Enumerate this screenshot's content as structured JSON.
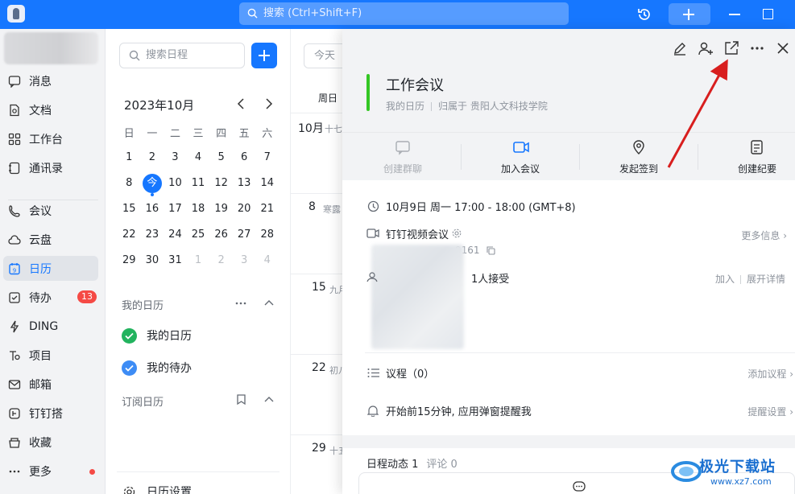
{
  "topbar": {
    "search_placeholder": "搜索 (Ctrl+Shift+F)",
    "accent": "#1677ff"
  },
  "nav": {
    "items": [
      {
        "label": "消息",
        "icon": "message-icon"
      },
      {
        "label": "文档",
        "icon": "document-icon"
      },
      {
        "label": "工作台",
        "icon": "workbench-icon"
      },
      {
        "label": "通讯录",
        "icon": "contacts-icon"
      },
      {
        "label": "会议",
        "icon": "meeting-icon"
      },
      {
        "label": "云盘",
        "icon": "cloud-drive-icon"
      },
      {
        "label": "日历",
        "icon": "calendar-icon",
        "active": true
      },
      {
        "label": "待办",
        "icon": "todo-icon",
        "badge": "13"
      },
      {
        "label": "DING",
        "icon": "lightning-icon"
      },
      {
        "label": "项目",
        "icon": "project-icon"
      },
      {
        "label": "邮箱",
        "icon": "mail-icon"
      },
      {
        "label": "钉钉搭",
        "icon": "builder-icon"
      },
      {
        "label": "收藏",
        "icon": "favorites-icon"
      },
      {
        "label": "更多",
        "icon": "more-icon",
        "dot": true
      }
    ]
  },
  "calendar": {
    "search_placeholder": "搜索日程",
    "month_title": "2023年10月",
    "weekdays": [
      "日",
      "一",
      "二",
      "三",
      "四",
      "五",
      "六"
    ],
    "weeks": [
      [
        "1",
        "2",
        "3",
        "4",
        "5",
        "6",
        "7"
      ],
      [
        "8",
        "今",
        "10",
        "11",
        "12",
        "13",
        "14"
      ],
      [
        "15",
        "16",
        "17",
        "18",
        "19",
        "20",
        "21"
      ],
      [
        "22",
        "23",
        "24",
        "25",
        "26",
        "27",
        "28"
      ],
      [
        "29",
        "30",
        "31",
        "1",
        "2",
        "3",
        "4"
      ]
    ],
    "my_calendars_title": "我的日历",
    "my_calendars": [
      {
        "label": "我的日历",
        "color": "#22b35e"
      },
      {
        "label": "我的待办",
        "color": "#3d8cf5"
      }
    ],
    "subscribed_title": "订阅日历",
    "settings_label": "日历设置"
  },
  "week": {
    "today_label": "今天",
    "header": "周日",
    "days": [
      {
        "num": "10月",
        "lunar": "十七"
      },
      {
        "num": "8",
        "lunar": "寒露"
      },
      {
        "num": "15",
        "lunar": "九月"
      },
      {
        "num": "22",
        "lunar": "初八"
      },
      {
        "num": "29",
        "lunar": "十五"
      }
    ]
  },
  "event": {
    "title": "工作会议",
    "calendar": "我的日历",
    "owner": "归属于 贵阳人文科技学院",
    "color": "#34c724",
    "actions": [
      {
        "label": "创建群聊",
        "icon": "chat-bubble-icon",
        "disabled": true
      },
      {
        "label": "加入会议",
        "icon": "video-camera-icon"
      },
      {
        "label": "发起签到",
        "icon": "location-pin-icon"
      },
      {
        "label": "创建纪要",
        "icon": "notes-icon"
      }
    ],
    "time": "10月9日 周一 17:00 - 18:00 (GMT+8)",
    "video_meeting": "钉钉视频会议",
    "meeting_id_suffix": "9161",
    "more_info": "更多信息",
    "attendees_text": "1人接受",
    "join_label": "加入",
    "expand_label": "展开详情",
    "agenda_label": "议程（0）",
    "add_agenda": "添加议程",
    "reminder": "开始前15分钟, 应用弹窗提醒我",
    "reminder_settings": "提醒设置",
    "activity_label": "日程动态 1",
    "comments_label": "评论 0"
  },
  "watermark": {
    "text": "极光下载站",
    "url": "www.xz7.com"
  }
}
